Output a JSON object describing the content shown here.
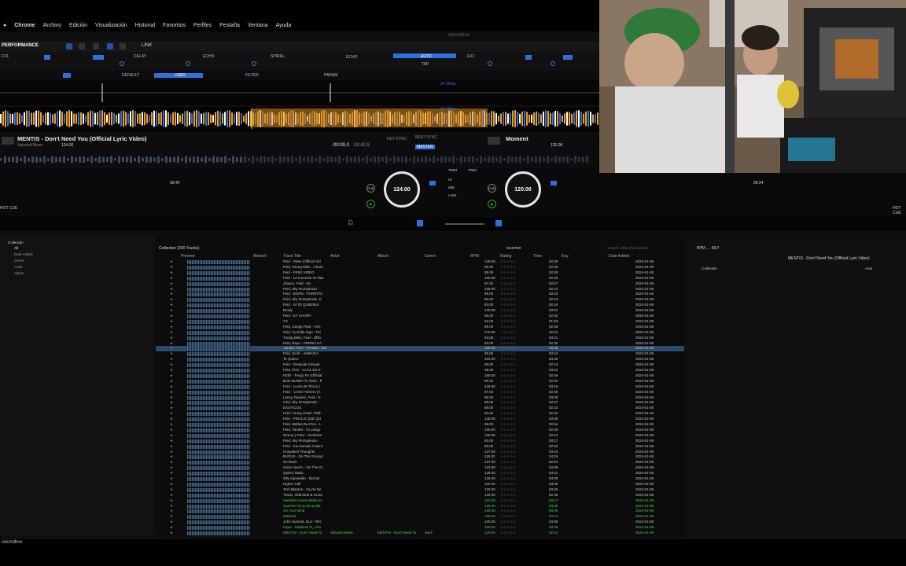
{
  "menubar": {
    "app": "Chrome",
    "items": [
      "Archivo",
      "Edición",
      "Visualización",
      "Historial",
      "Favoritos",
      "Perfiles",
      "Pestaña",
      "Ventana",
      "Ayuda"
    ]
  },
  "window_title": "rekordbox",
  "toolbar": {
    "mode": "PERFORMANCE",
    "link": "LINK"
  },
  "fx": {
    "left_unit": "FX1",
    "right_unit": "FX2",
    "effects": [
      "DELAY",
      "ECHO",
      "SPIRAL"
    ],
    "right_fx": "ECHO",
    "auto_label": "AUTO",
    "tap_label": "TAP",
    "default_label": "DEFAULT",
    "user_label": "USER",
    "filter_label": "FILTER",
    "param_label": "PARAM"
  },
  "waveform": {
    "marker1": "84.3Bars",
    "marker2": "31.4Bars"
  },
  "deck1": {
    "title": "MENTIS - Don't Need You (Official Lyric Video)",
    "artist": "Xploded Music",
    "bpm": "124.00",
    "time": "-00:00.0",
    "total": "02:42.9",
    "key_sync": "KEY SYNC",
    "beat_sync": "BEAT SYNC",
    "master": "MASTER",
    "cue_time": "00:42",
    "jog_bpm": "124.00"
  },
  "deck2": {
    "title": "Moment",
    "bpm": "120.00",
    "jog_bpm": "120.00",
    "cue_time": "00:24"
  },
  "mixer": {
    "trim": "TRIM",
    "hi": "HI",
    "mid": "MID",
    "low": "LOW",
    "cue": "CUE"
  },
  "hot_cue": "HOT CUE",
  "browser": {
    "tree_items": [
      "Collection",
      "All",
      "Date Added",
      "Genre",
      "Artist",
      "Album"
    ],
    "collection_label": "Collection (330 Tracks)",
    "search_placeholder": "Search within the track list",
    "columns": [
      "Preview",
      "Artwork",
      "Track Title",
      "Artist",
      "Album",
      "Genre",
      "BPM",
      "Rating",
      "Time",
      "Key",
      "Date Added"
    ],
    "master_label": "MASTER",
    "tracks": [
      {
        "title": "Feid - Yikes (Official Vid",
        "bpm": "128.00",
        "time": "02:30",
        "date": "2024-01-08"
      },
      {
        "title": "Feid, Young Miko - Cham",
        "bpm": "98.00",
        "time": "02:39",
        "date": "2024-01-08"
      },
      {
        "title": "Feid - FRIKI VIDEO",
        "bpm": "95.00",
        "time": "02:49",
        "date": "2024-01-08"
      },
      {
        "title": "Feid - La Inocente mi Ñas",
        "bpm": "160.00",
        "time": "02:40",
        "date": "2024-01-08"
      },
      {
        "title": "Jhayco, Feid - Ex-",
        "bpm": "97.00",
        "time": "02:57",
        "date": "2024-01-08"
      },
      {
        "title": "Feid, Sky Rompiendo -",
        "bpm": "105.00",
        "time": "02:41",
        "date": "2024-01-08"
      },
      {
        "title": "Feid - BORN - PURRITO",
        "bpm": "99.00",
        "time": "03:20",
        "date": "2024-01-08"
      },
      {
        "title": "Feid, Sky Rompiendo, D",
        "bpm": "96.00",
        "time": "02:43",
        "date": "2024-01-08"
      },
      {
        "title": "Feid - SI TE QUIERES",
        "bpm": "93.00",
        "time": "02:44",
        "date": "2024-01-08"
      },
      {
        "title": "Brody",
        "bpm": "130.00",
        "time": "03:04",
        "date": "2024-01-08"
      },
      {
        "title": "Feid - EY CHORY",
        "bpm": "95.00",
        "time": "02:30",
        "date": "2024-01-08"
      },
      {
        "title": "XX",
        "bpm": "92.00",
        "time": "01:53",
        "date": "2024-01-08"
      },
      {
        "title": "Feid, Gangs Flow - Gris",
        "bpm": "99.00",
        "time": "02:46",
        "date": "2024-01-08"
      },
      {
        "title": "Feid, Ty Dolla Sign - Fei",
        "bpm": "170.00",
        "time": "02:42",
        "date": "2024-01-08"
      },
      {
        "title": "Young Miko, Feid - offlin",
        "bpm": "93.00",
        "time": "03:21",
        "date": "2024-01-08"
      },
      {
        "title": "Feid, Rayo - PERRO KA",
        "bpm": "93.00",
        "time": "02:35",
        "date": "2024-01-08"
      },
      {
        "title": "Yandel, Feid - YANDEL 150",
        "bpm": "168.00",
        "time": "03:36",
        "date": "2024-01-08"
      },
      {
        "title": "Feid, Sech - JAMAICA",
        "bpm": "95.00",
        "time": "03:44",
        "date": "2024-01-08"
      },
      {
        "title": "Te Quiero",
        "bpm": "103.00",
        "time": "03:36",
        "date": "2024-01-08"
      },
      {
        "title": "Feid - Desquite (Visuali",
        "bpm": "96.00",
        "time": "02:13",
        "date": "2024-01-08"
      },
      {
        "title": "Feid, Pirlo - CUAL ES E",
        "bpm": "98.00",
        "time": "03:01",
        "date": "2024-01-08"
      },
      {
        "title": "FEID - Tengo Fe (Official",
        "bpm": "160.00",
        "time": "02:46",
        "date": "2024-01-08"
      },
      {
        "title": "BAD BUNNY ft. FEID - P",
        "bpm": "96.00",
        "time": "02:42",
        "date": "2024-01-08"
      },
      {
        "title": "Feid - Luces de Tecno (",
        "bpm": "128.00",
        "time": "03:16",
        "date": "2024-01-08"
      },
      {
        "title": "Feid - 14 De Febrero (A",
        "bpm": "97.00",
        "time": "02:49",
        "date": "2024-01-08"
      },
      {
        "title": "Lenny Tavárez, Feid - E",
        "bpm": "95.00",
        "time": "03:08",
        "date": "2024-01-08"
      },
      {
        "title": "Feid, Sky Rompiendo -",
        "bpm": "98.00",
        "time": "02:57",
        "date": "2024-01-08"
      },
      {
        "title": "EXOTICOS",
        "bpm": "89.00",
        "time": "02:22",
        "date": "2024-01-08"
      },
      {
        "title": "Feid, Young Cister, Paill",
        "bpm": "93.00",
        "time": "02:40",
        "date": "2024-01-08"
      },
      {
        "title": "Feid - PIDALO QUE QU",
        "bpm": "130.00",
        "time": "03:05",
        "date": "2024-01-08"
      },
      {
        "title": "Feid, Mañas Ru-Fino - L",
        "bpm": "99.00",
        "time": "02:54",
        "date": "2024-01-08"
      },
      {
        "title": "Feid, Yandel - Yo Jangu",
        "bpm": "160.00",
        "time": "02:46",
        "date": "2024-01-08"
      },
      {
        "title": "Ozuna y Feid - Hombres",
        "bpm": "100.00",
        "time": "03:12",
        "date": "2024-01-08"
      },
      {
        "title": "Feid, Sky Rompiendo -",
        "bpm": "93.00",
        "time": "03:17",
        "date": "2024-01-08"
      },
      {
        "title": "Feid - Ca-moncito Calent",
        "bpm": "98.00",
        "time": "02:42",
        "date": "2024-01-08"
      },
      {
        "title": "Unspoken Thoughts",
        "bpm": "127.00",
        "time": "03:33",
        "date": "2024-01-08"
      },
      {
        "title": "RÜFÜS - On The Ground",
        "bpm": "118.00",
        "time": "04:24",
        "date": "2024-01-08"
      },
      {
        "title": "So Much",
        "bpm": "127.00",
        "time": "02:54",
        "date": "2024-01-08"
      },
      {
        "title": "oscar med K - On The Gr",
        "bpm": "123.00",
        "time": "04:05",
        "date": "2024-01-08"
      },
      {
        "title": "Quiero Nada",
        "bpm": "128.00",
        "time": "03:21",
        "date": "2024-01-08"
      },
      {
        "title": "Olly Alexander - Dizzier",
        "bpm": "126.00",
        "time": "03:09",
        "date": "2024-01-08"
      },
      {
        "title": "Higher Call",
        "bpm": "122.00",
        "time": "03:06",
        "date": "2024-01-08"
      },
      {
        "title": "Terri Blanton - You're Ne",
        "bpm": "123.00",
        "time": "03:25",
        "date": "2024-01-08"
      },
      {
        "title": "Tiesto, Odd Mob & Good",
        "bpm": "130.00",
        "time": "02:46",
        "date": "2024-01-08"
      },
      {
        "title": "Swedish House Mafia an",
        "bpm": "124.00",
        "time": "03:17",
        "date": "2024-01-08",
        "green": true
      },
      {
        "title": "Summer 01 (Lost up Ba",
        "bpm": "126.00",
        "time": "03:06",
        "date": "2024-01-08",
        "green": true
      },
      {
        "title": "On Your Mind",
        "bpm": "128.00",
        "time": "03:06",
        "date": "2024-01-08",
        "green": true
      },
      {
        "title": "Material",
        "bpm": "126.00",
        "time": "04:41",
        "date": "2024-01-08",
        "green": true
      },
      {
        "title": "John Summit, Guz - WH",
        "bpm": "126.00",
        "time": "04:08",
        "date": "2024-01-08"
      },
      {
        "title": "Kapo - Palabras R_Lina",
        "bpm": "100.00",
        "time": "03:48",
        "date": "2024-01-08",
        "green": true
      },
      {
        "title": "MENTIS - Don't Need To",
        "artist": "Xploded Music",
        "album": "MENTIS - Don't Need To",
        "genre": "Mark",
        "bpm": "124.00",
        "time": "02:42",
        "date": "2024-01-08",
        "green": true
      }
    ],
    "selected_index": 16
  },
  "right_panel": {
    "label": "BPM ↔ KEY",
    "now_playing": "MENTIS - Don't Need You (Official Lyric Video)",
    "collection": "Collection",
    "auto": "Auto"
  },
  "footer": {
    "brand": "rekordbox"
  },
  "colors": {
    "accent": "#2f6fe0",
    "wave_orange": "#f0a020",
    "selected_row": "#2a4a6a",
    "green_row": "#4fd04f"
  }
}
